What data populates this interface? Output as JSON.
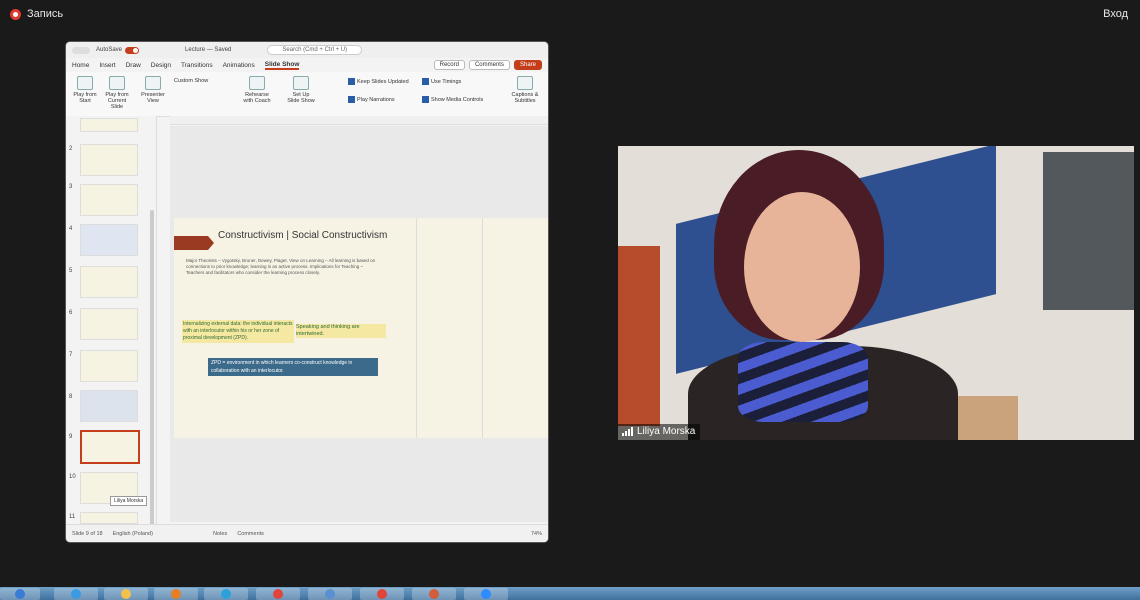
{
  "top": {
    "record_label": "Запись",
    "exit_label": "Вход"
  },
  "ppt": {
    "autosave_label": "AutoSave",
    "doc_title": "Lecture — Saved",
    "search_placeholder": "Search (Cmd + Ctrl + U)",
    "tabs": [
      "Home",
      "Insert",
      "Draw",
      "Design",
      "Transitions",
      "Animations",
      "Slide Show"
    ],
    "record_label": "Record",
    "comments_label": "Comments",
    "share_label": "Share",
    "ribbon": {
      "play_from_start": "Play from Start",
      "play_from_current": "Play from Current Slide",
      "presenter_view": "Presenter View",
      "custom_show": "Custom Show",
      "rehearse": "Rehearse with Coach",
      "set_up": "Set Up Slide Show",
      "keep_slides_updated": "Keep Slides Updated",
      "use_timings": "Use Timings",
      "play_narrations": "Play Narrations",
      "show_media_controls": "Show Media Controls",
      "subtitles": "Captions & Subtitles"
    },
    "slide_numbers": [
      "2",
      "3",
      "4",
      "5",
      "6",
      "7",
      "8",
      "9",
      "10",
      "11"
    ],
    "tooltip": "Liliya Morska",
    "slide": {
      "title": "Constructivism | Social Constructivism",
      "body": "Major Theorists – Vygotsky, Bruner, Dewey, Piaget. View on Learning – All learning is based on connections to prior knowledge; learning is an active process. Implications for Teaching – Teachers and facilitators who consider the learning process closely.",
      "highlight1": "Internalizing external data: the individual interacts with an interlocutor within his or her zone of proximal development (ZPD).",
      "highlight2": "Speaking and thinking are intertwined.",
      "highlight3": "ZPD = environment in which learners co-construct knowledge in collaboration with an interlocutor."
    },
    "status": {
      "slide_info": "Slide 9 of 18",
      "language": "English (Poland)",
      "notes": "Notes",
      "comments": "Comments",
      "zoom": "74%"
    }
  },
  "video": {
    "participant_name": "Liliya Morska"
  },
  "colors": {
    "accent": "#c43e1c",
    "background": "#1a1a1a"
  }
}
